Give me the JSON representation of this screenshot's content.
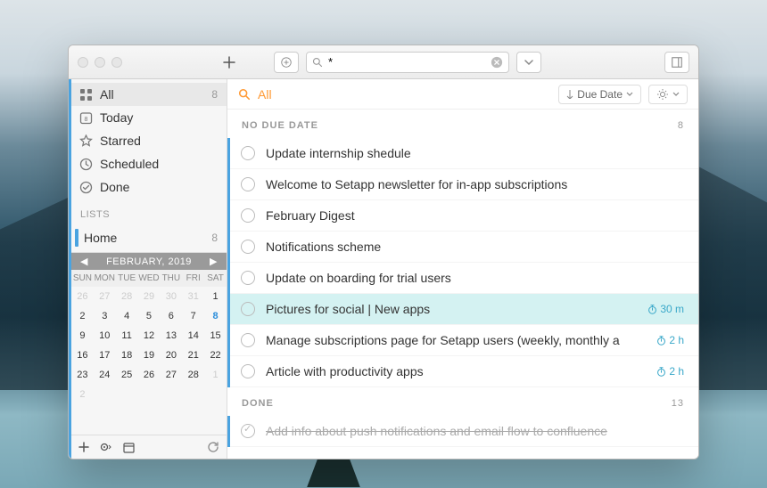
{
  "toolbar": {
    "search_value": "*"
  },
  "sidebar": {
    "smart": [
      {
        "icon": "grid",
        "label": "All",
        "count": "8",
        "active": true
      },
      {
        "icon": "calendar-day",
        "label": "Today",
        "count": ""
      },
      {
        "icon": "star",
        "label": "Starred",
        "count": ""
      },
      {
        "icon": "clock",
        "label": "Scheduled",
        "count": ""
      },
      {
        "icon": "check",
        "label": "Done",
        "count": ""
      }
    ],
    "lists_header": "LISTS",
    "lists": [
      {
        "color": "#4aa3e0",
        "label": "Home",
        "count": "8"
      }
    ]
  },
  "calendar": {
    "label": "FEBRUARY, 2019",
    "dow": [
      "SUN",
      "MON",
      "TUE",
      "WED",
      "THU",
      "FRI",
      "SAT"
    ],
    "weeks": [
      [
        "26",
        "27",
        "28",
        "29",
        "30",
        "31",
        "1"
      ],
      [
        "2",
        "3",
        "4",
        "5",
        "6",
        "7",
        "8",
        "9"
      ],
      [
        "10",
        "11",
        "12",
        "13",
        "14",
        "15",
        "16"
      ],
      [
        "17",
        "18",
        "19",
        "20",
        "21",
        "22",
        "23"
      ],
      [
        "24",
        "25",
        "26",
        "27",
        "28",
        "1",
        "2"
      ]
    ],
    "dim_head": 6,
    "dim_tail": 2,
    "today": "8"
  },
  "main": {
    "title": "All",
    "sort_label": "Due Date",
    "sections": [
      {
        "title": "NO DUE DATE",
        "count": "8",
        "tasks": [
          {
            "title": "Update internship shedule",
            "meta": "",
            "selected": false
          },
          {
            "title": "Welcome to Setapp newsletter for in-app subscriptions",
            "meta": "",
            "selected": false
          },
          {
            "title": "February Digest",
            "meta": "",
            "selected": false
          },
          {
            "title": "Notifications scheme",
            "meta": "",
            "selected": false
          },
          {
            "title": "Update on boarding for trial users",
            "meta": "",
            "selected": false
          },
          {
            "title": "Pictures for social | New apps",
            "meta": "30 m",
            "selected": true
          },
          {
            "title": "Manage subscriptions page for Setapp users (weekly, monthly a",
            "meta": "2 h",
            "selected": false
          },
          {
            "title": "Article with productivity apps",
            "meta": "2 h",
            "selected": false
          }
        ]
      },
      {
        "title": "DONE",
        "count": "13",
        "tasks": [
          {
            "title": "Add info about push notifications and email flow to confluence",
            "meta": "",
            "done": true
          }
        ]
      }
    ]
  }
}
